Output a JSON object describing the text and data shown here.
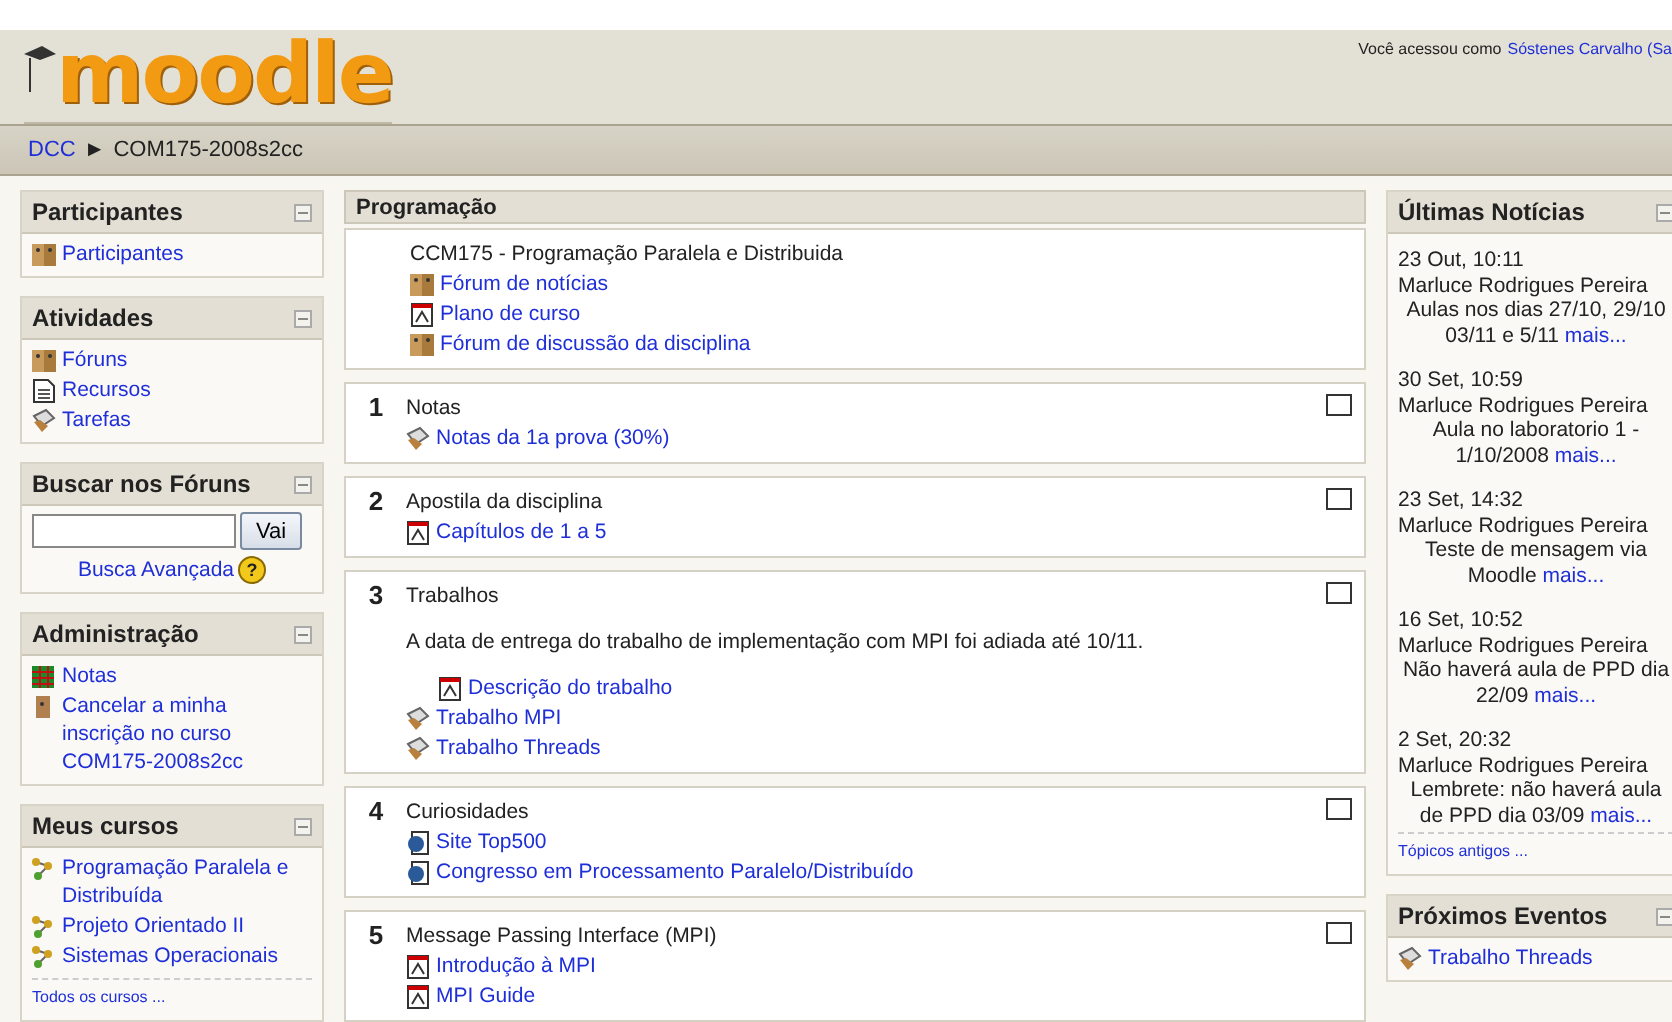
{
  "header": {
    "logo": "moodle",
    "login_text": "Você acessou como",
    "login_user": "Sóstenes Carvalho (Sa"
  },
  "breadcrumb": [
    {
      "label": "DCC",
      "link": true
    },
    {
      "label": "COM175-2008s2cc",
      "link": false
    }
  ],
  "breadcrumb_separator": "►",
  "left_blocks": [
    {
      "kind": "links",
      "title": "Participantes",
      "items": [
        {
          "kind": "forum",
          "label": "Participantes"
        }
      ]
    },
    {
      "kind": "links",
      "title": "Atividades",
      "items": [
        {
          "kind": "forum",
          "label": "Fóruns"
        },
        {
          "kind": "resource",
          "label": "Recursos"
        },
        {
          "kind": "assignment",
          "label": "Tarefas"
        }
      ]
    },
    {
      "kind": "search",
      "title": "Buscar nos Fóruns",
      "button": "Vai",
      "advanced": "Busca Avançada",
      "help": "?"
    },
    {
      "kind": "links",
      "title": "Administração",
      "items": [
        {
          "kind": "grades",
          "label": "Notas"
        },
        {
          "kind": "person",
          "label": "Cancelar a minha inscrição no curso COM175-2008s2cc"
        }
      ]
    },
    {
      "kind": "links",
      "title": "Meus cursos",
      "items": [
        {
          "kind": "course",
          "label": "Programação Paralela e Distribuída"
        },
        {
          "kind": "course",
          "label": "Projeto Orientado II"
        },
        {
          "kind": "course",
          "label": "Sistemas Operacionais"
        }
      ],
      "footer": "Todos os cursos ..."
    }
  ],
  "main": {
    "title": "Programação",
    "sections": [
      {
        "summary": "CCM175 - Programação Paralela e Distribuida",
        "items": [
          {
            "kind": "forum",
            "label": "Fórum de notícias"
          },
          {
            "kind": "pdf",
            "label": "Plano de curso"
          },
          {
            "kind": "forum",
            "label": "Fórum de discussão da disciplina"
          }
        ]
      },
      {
        "number": "1",
        "summary": "Notas",
        "items": [
          {
            "kind": "assignment",
            "label": "Notas da 1a prova (30%)"
          }
        ]
      },
      {
        "number": "2",
        "summary": "Apostila da disciplina",
        "items": [
          {
            "kind": "pdf",
            "label": "Capítulos de 1 a 5"
          }
        ]
      },
      {
        "number": "3",
        "summary": "Trabalhos",
        "note": "A data de entrega do trabalho de implementação com MPI foi adiada até 10/11.",
        "items": [
          {
            "kind": "pdf",
            "label": "Descrição do trabalho",
            "indent": true
          },
          {
            "kind": "assignment",
            "label": "Trabalho MPI"
          },
          {
            "kind": "assignment",
            "label": "Trabalho Threads"
          }
        ]
      },
      {
        "number": "4",
        "summary": "Curiosidades",
        "items": [
          {
            "kind": "web",
            "label": "Site Top500"
          },
          {
            "kind": "web",
            "label": "Congresso em Processamento Paralelo/Distribuído"
          }
        ]
      },
      {
        "number": "5",
        "summary": "Message Passing Interface (MPI)",
        "items": [
          {
            "kind": "pdf",
            "label": "Introdução à MPI"
          },
          {
            "kind": "pdf",
            "label": "MPI Guide"
          }
        ]
      }
    ]
  },
  "news": {
    "title": "Últimas Notícias",
    "items": [
      {
        "date": "23 Out, 10:11",
        "author": "Marluce Rodrigues Pereira",
        "text": "Aulas nos dias 27/10, 29/10 03/11 e 5/11",
        "more": "mais..."
      },
      {
        "date": "30 Set, 10:59",
        "author": "Marluce Rodrigues Pereira",
        "text": "Aula no laboratorio 1 - 1/10/2008",
        "more": "mais..."
      },
      {
        "date": "23 Set, 14:32",
        "author": "Marluce Rodrigues Pereira",
        "text": "Teste de mensagem via Moodle",
        "more": "mais..."
      },
      {
        "date": "16 Set, 10:52",
        "author": "Marluce Rodrigues Pereira",
        "text": "Não haverá aula de PPD dia 22/09",
        "more": "mais..."
      },
      {
        "date": "2 Set, 20:32",
        "author": "Marluce Rodrigues Pereira",
        "text": "Lembrete: não haverá aula de PPD dia 03/09",
        "more": "mais..."
      }
    ],
    "footer": "Tópicos antigos ..."
  },
  "events": {
    "title": "Próximos Eventos",
    "items": [
      {
        "kind": "assignment",
        "label": "Trabalho Threads"
      }
    ]
  }
}
